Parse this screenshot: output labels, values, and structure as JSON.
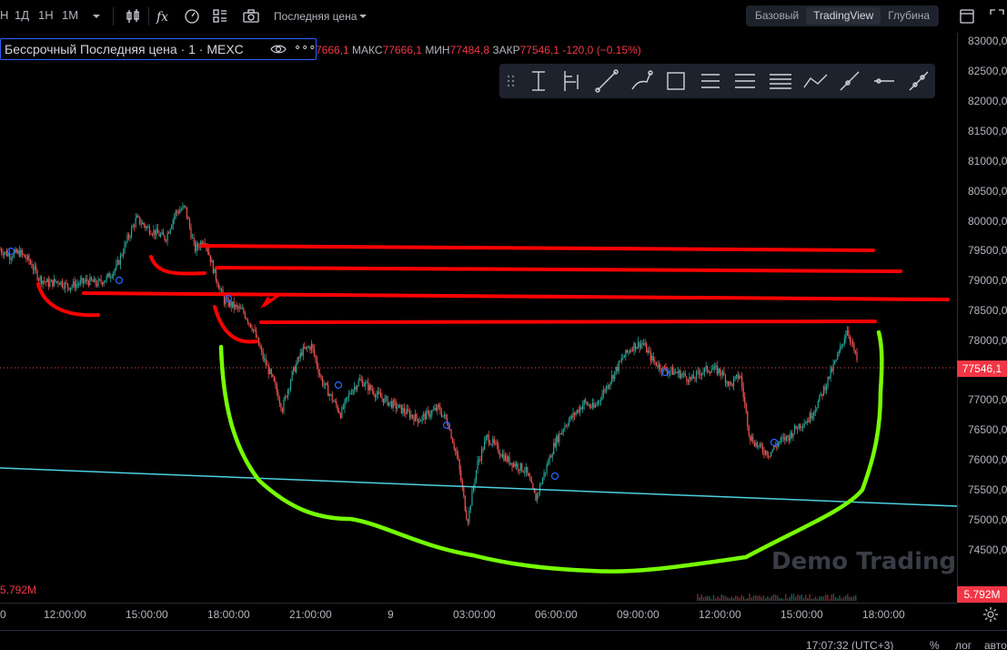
{
  "toolbar": {
    "intervals": [
      "Н",
      "1Д",
      "1Н",
      "1М"
    ],
    "price_type": "Последняя цена",
    "view_tabs": [
      "Базовый",
      "TradingView",
      "Глубина"
    ],
    "active_view": "TradingView"
  },
  "legend": {
    "title": "Бессрочный Последняя цена · 1 · MEXC",
    "open_fragment": "7666,1",
    "high_label": "МАКС",
    "high_value": "77666,1",
    "low_label": "МИН",
    "low_value": "77484,8",
    "close_label": "ЗАКР",
    "close_value": "77546,1",
    "change": "-120,0 (−0.15%)"
  },
  "drawing_tools": [
    "cursor-range-icon",
    "fib-icon",
    "trendline-icon",
    "brush-icon",
    "rectangle-icon",
    "parallel-channel-icon",
    "pitchfork-icon",
    "lines-icon",
    "path-icon",
    "ray-icon",
    "horizontal-line-icon",
    "extended-line-icon"
  ],
  "watermark": "Demo Trading",
  "volume_label": "5.792M",
  "price_axis": {
    "ticks": [
      "83000,0",
      "82500,0",
      "82000,0",
      "81500,0",
      "81000,0",
      "80500,0",
      "80000,0",
      "79500,0",
      "79000,0",
      "78500,0",
      "78000,0",
      "77000,0",
      "76500,0",
      "76000,0",
      "75500,0",
      "75000,0",
      "74500,0"
    ],
    "current_price": "77546,1",
    "volume_value": "5.792M"
  },
  "time_axis": {
    "ticks": [
      "0",
      "12:00:00",
      "15:00:00",
      "18:00:00",
      "21:00:00",
      "9",
      "03:00:00",
      "06:00:00",
      "09:00:00",
      "12:00:00",
      "15:00:00",
      "18:00:00"
    ]
  },
  "bottom_bar": {
    "clock": "17:07:32 (UTC+3)",
    "percent": "%",
    "log": "лог",
    "auto": "авто"
  },
  "colors": {
    "up": "#26a69a",
    "down": "#ef5350",
    "drawing_red": "#ff0000",
    "drawing_green": "#76ff03",
    "trend_line": "#4dd0e1",
    "accent": "#2962ff"
  },
  "chart_data": {
    "type": "candlestick",
    "symbol": "Бессрочный Последняя цена · 1 · MEXC",
    "ylim": [
      74200,
      83200
    ],
    "close_series": [
      79500,
      79400,
      79450,
      79300,
      79000,
      78900,
      78950,
      78850,
      78900,
      78950,
      78900,
      79000,
      79200,
      79650,
      80050,
      79900,
      79800,
      79700,
      80150,
      80250,
      79500,
      79700,
      79100,
      78600,
      78500,
      78400,
      78100,
      77600,
      77200,
      76700,
      77300,
      77700,
      77800,
      77200,
      76900,
      76600,
      77000,
      77200,
      77050,
      76900,
      76800,
      76700,
      76600,
      76500,
      76600,
      76700,
      76450,
      75800,
      74700,
      75700,
      76200,
      76000,
      75800,
      75700,
      75600,
      75100,
      75600,
      76100,
      76400,
      76600,
      76800,
      76700,
      77000,
      77300,
      77600,
      77800,
      77850,
      77550,
      77400,
      77350,
      77300,
      77200,
      77350,
      77400,
      77350,
      77100,
      77300,
      76200,
      76000,
      75900,
      76100,
      76200,
      76400,
      76500,
      76800,
      77200,
      77600,
      78100,
      77546
    ],
    "last_price": 77546.1
  }
}
